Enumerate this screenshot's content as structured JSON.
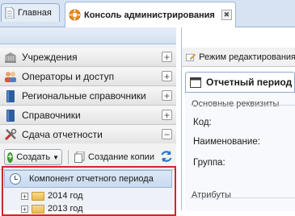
{
  "tabs": [
    {
      "label": "Главная",
      "icon": "document-icon"
    },
    {
      "label": "Консоль администрирования",
      "icon": "orange-gear-icon",
      "close": "✖"
    }
  ],
  "sidebar": {
    "items": [
      {
        "label": "Учреждения",
        "icon": "building-icon",
        "toggle": "+"
      },
      {
        "label": "Операторы и доступ",
        "icon": "users-icon",
        "toggle": "+"
      },
      {
        "label": "Региональные справочники",
        "icon": "book-icon",
        "toggle": "+"
      },
      {
        "label": "Справочники",
        "icon": "book-icon",
        "toggle": "+"
      },
      {
        "label": "Сдача отчетности",
        "icon": "tools-icon",
        "toggle": "−"
      }
    ],
    "toolbar": {
      "create_label": "Создать",
      "copy_label": "Создание копии"
    },
    "menu": {
      "item_label": "Компонент отчетного периода"
    },
    "tree": [
      {
        "label": "2014 год",
        "toggle": "+"
      },
      {
        "label": "2013 год",
        "toggle": "+"
      }
    ]
  },
  "right": {
    "edit_mode_label": "Режим редактирования",
    "tab_label": "Отчетный период",
    "section_main": "Основные реквизиты",
    "fields": [
      "Код:",
      "Наименование:",
      "Группа:"
    ],
    "section_attrs": "Атрибуты"
  },
  "colors": {
    "highlight_border": "#d0262d",
    "accent": "#99b4d6"
  }
}
